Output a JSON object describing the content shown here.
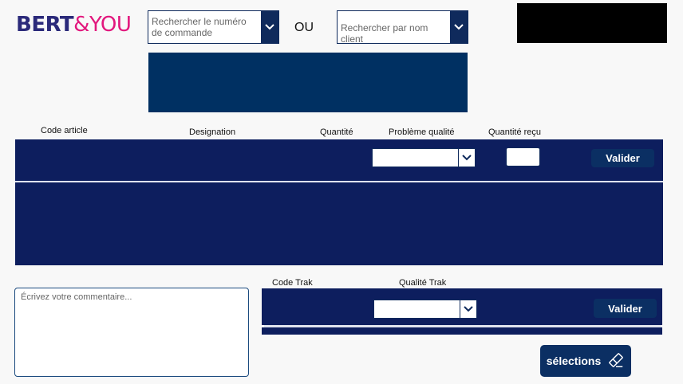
{
  "logo": {
    "part1": "BERT",
    "part2": "&YOU"
  },
  "search": {
    "order_placeholder": "Rechercher le numéro de commande",
    "or_label": "OU",
    "client_placeholder": "Rechercher par nom client"
  },
  "table": {
    "headers": {
      "code_article": "Code article",
      "designation": "Designation",
      "quantite": "Quantité",
      "probleme_qualite": "Problème qualité",
      "quantite_recu": "Quantité reçu"
    },
    "validate_label": "Valider"
  },
  "comment": {
    "placeholder": "Écrivez votre commentaire..."
  },
  "trak": {
    "headers": {
      "code_trak": "Code Trak",
      "qualite_trak": "Qualité Trak"
    },
    "validate_label": "Valider"
  },
  "selections": {
    "label": "sélections",
    "icon": "eraser-icon"
  },
  "colors": {
    "navy_band": "#0d1e5e",
    "panel": "#003062",
    "button": "#0b2f63",
    "logo_primary": "#2b2a7a",
    "logo_accent": "#e2177d"
  }
}
